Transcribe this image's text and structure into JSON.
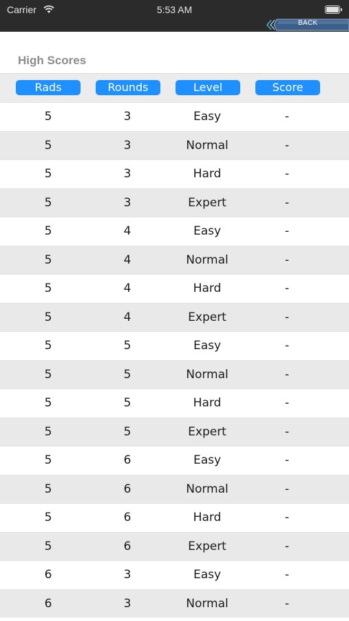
{
  "status_bar": {
    "carrier": "Carrier",
    "time": "5:53 AM"
  },
  "nav": {
    "back_label": "BACK"
  },
  "title": "High Scores",
  "columns": [
    "Rads",
    "Rounds",
    "Level",
    "Score"
  ],
  "rows": [
    [
      "5",
      "3",
      "Easy",
      "-"
    ],
    [
      "5",
      "3",
      "Normal",
      "-"
    ],
    [
      "5",
      "3",
      "Hard",
      "-"
    ],
    [
      "5",
      "3",
      "Expert",
      "-"
    ],
    [
      "5",
      "4",
      "Easy",
      "-"
    ],
    [
      "5",
      "4",
      "Normal",
      "-"
    ],
    [
      "5",
      "4",
      "Hard",
      "-"
    ],
    [
      "5",
      "4",
      "Expert",
      "-"
    ],
    [
      "5",
      "5",
      "Easy",
      "-"
    ],
    [
      "5",
      "5",
      "Normal",
      "-"
    ],
    [
      "5",
      "5",
      "Hard",
      "-"
    ],
    [
      "5",
      "5",
      "Expert",
      "-"
    ],
    [
      "5",
      "6",
      "Easy",
      "-"
    ],
    [
      "5",
      "6",
      "Normal",
      "-"
    ],
    [
      "5",
      "6",
      "Hard",
      "-"
    ],
    [
      "5",
      "6",
      "Expert",
      "-"
    ],
    [
      "6",
      "3",
      "Easy",
      "-"
    ],
    [
      "6",
      "3",
      "Normal",
      "-"
    ]
  ],
  "colors": {
    "header_button": "#1e90ff",
    "status_bar": "#2b2b2b",
    "alt_row": "#e9e9e9"
  },
  "icons": {
    "wifi": "wifi-icon",
    "battery": "battery-icon",
    "back": "chevron-left-icon"
  }
}
